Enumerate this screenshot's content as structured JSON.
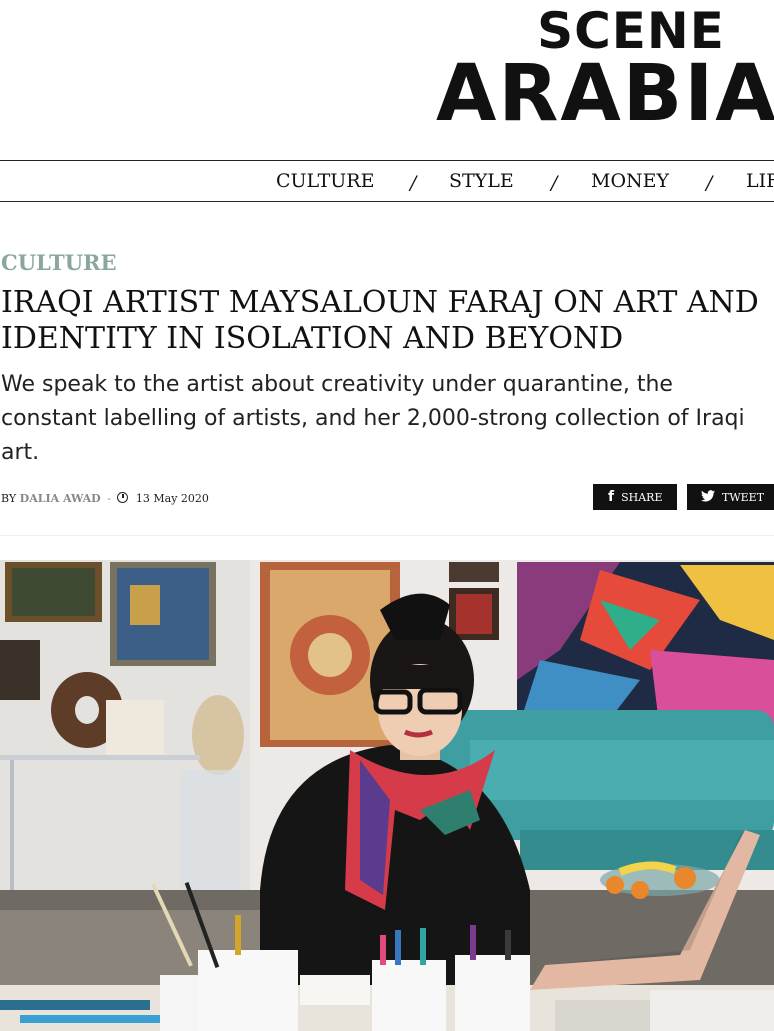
{
  "logo": {
    "line1": "SCENE",
    "line2": "ARABIA"
  },
  "nav": {
    "items": [
      "CULTURE",
      "STYLE",
      "MONEY",
      "LIF"
    ],
    "separator": "/"
  },
  "article": {
    "category": "CULTURE",
    "headline": "IRAQI ARTIST MAYSALOUN FARAJ ON ART AND IDENTITY IN ISOLATION AND BEYOND",
    "dek": "We speak to the artist about creativity under quarantine, the constant labelling of artists, and her 2,000-strong collection of Iraqi art.",
    "byline": {
      "by": "BY",
      "author": "DALIA AWAD",
      "dash": "-",
      "date": "13 May 2020"
    }
  },
  "share": {
    "share_label": "SHARE",
    "tweet_label": "TWEET",
    "share_icon": "facebook-icon",
    "tweet_icon": "twitter-icon"
  },
  "colors": {
    "category": "#8aa69e",
    "button_bg": "#111111",
    "text": "#111111"
  }
}
